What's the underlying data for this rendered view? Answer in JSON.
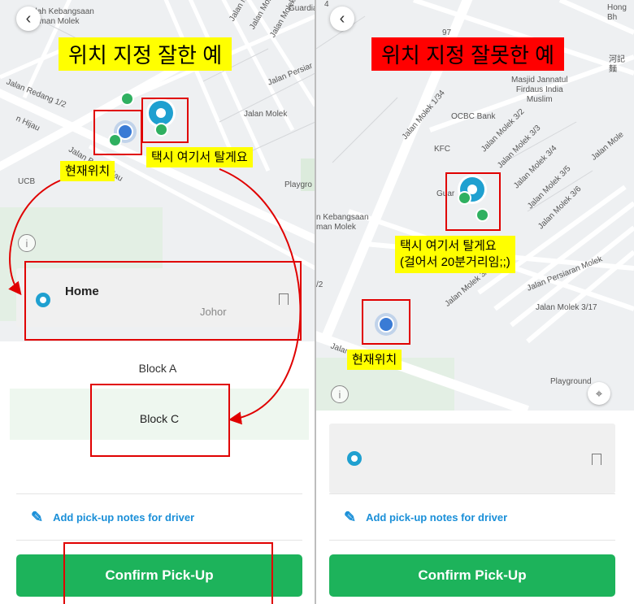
{
  "left": {
    "title": "위치 지정 잘한 예",
    "title_bg": "#ffff00",
    "current_location_label": "현재위치",
    "pickup_here_label": "택시 여기서 탈게요",
    "map_labels": {
      "taman": "olah Kebangsaan\nTaman Molek",
      "redang": "Jalan Redang 1/2",
      "hijau_top": "n Hijau",
      "persiaran": "Jalan Persiar",
      "molek1": "Jalan Molek 1/",
      "molek3": "Jalan Molek 3/",
      "molek3_6": "Jalan Molek 3/6",
      "molek_b": "Jalan Molek",
      "molek_c": "Jalan Molek",
      "guardian": "Guardian",
      "jalan_bumi": "Jalan Bumi Hijau",
      "ucb": "UCB",
      "playground": "Playgro"
    },
    "card": {
      "title": "Home",
      "subtitle": "Johor"
    },
    "options": [
      "Block A",
      "Block C"
    ],
    "notes_label": "Add pick-up notes for driver",
    "confirm_label": "Confirm Pick-Up"
  },
  "right": {
    "title": "위치 지정 잘못한 예",
    "title_bg": "#ff0000",
    "current_location_label": "현재위치",
    "pickup_here_line1": "택시 여기서 탈게요",
    "pickup_here_line2": "(걸어서 20분거리임;;)",
    "map_labels": {
      "mosque": "Masjid Jannatul\nFirdaus India\nMuslim",
      "ocbc": "OCBC Bank",
      "kfc": "KFC",
      "molek1_34": "Jalan Molek 1/34",
      "molek3_2": "Jalan Molek 3/2",
      "molek3_3": "Jalan Molek 3/3",
      "molek3_4": "Jalan Molek 3/4",
      "molek3_5": "Jalan Molek 3/5",
      "molek3_6": "Jalan Molek 3/6",
      "molek3_7": "Jalan Molek 3/7",
      "molek3_17": "Jalan Molek 3/17",
      "persiaran": "Jalan Persiaran Molek",
      "jalan_mole": "Jalan Mole",
      "jalan_bumi": "Jalan Bumi Hijau",
      "kebangsaan": "n Kebangsaan\nman Molek",
      "guardian": "Guar",
      "playground": "Playground",
      "hong": "Hong\nBh",
      "hokkien": "河記\n麵",
      "n97": "97",
      "n2_2": "/2",
      "n4": "4"
    },
    "notes_label": "Add pick-up notes for driver",
    "confirm_label": "Confirm Pick-Up"
  },
  "colors": {
    "accent_green": "#1db35b",
    "link_blue": "#1a8fd8",
    "pin_blue": "#1fa0d0",
    "annotation_red": "#e00000"
  }
}
